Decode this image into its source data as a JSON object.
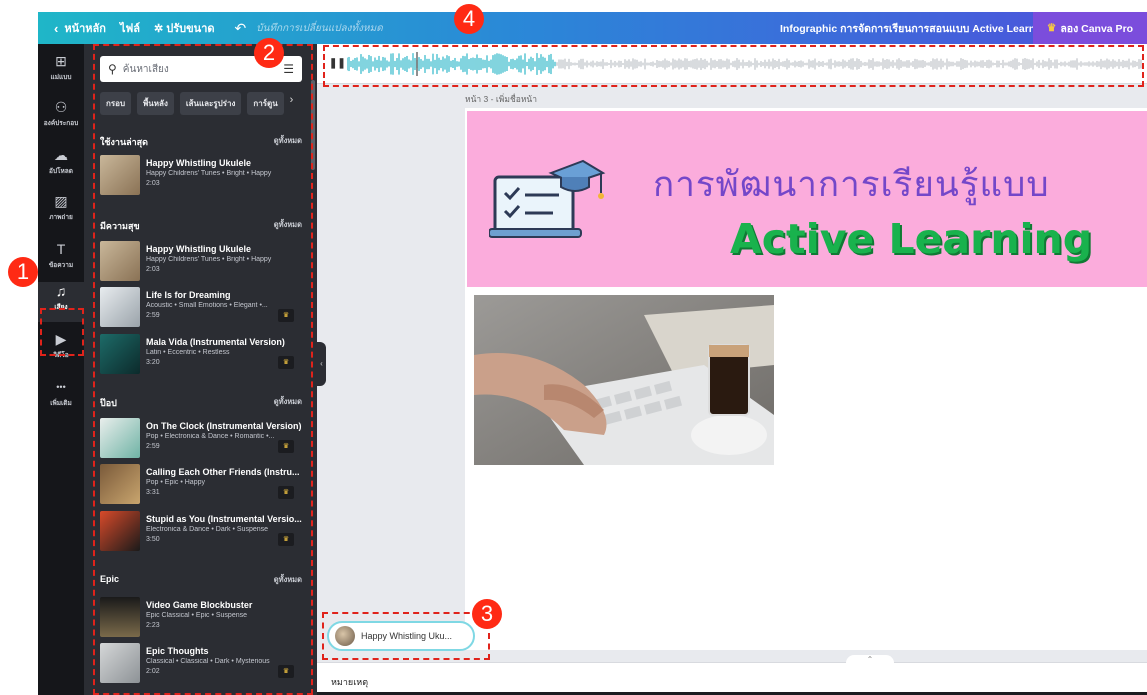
{
  "topbar": {
    "back_icon": "chevron-left-icon",
    "home_label": "หน้าหลัก",
    "file_label": "ไฟล์",
    "resize_label": "✲ ปรับขนาด",
    "undo_icon": "undo-icon",
    "autosave_text": "บันทึกการเปลี่ยนแปลงทั้งหมด",
    "doc_title": "Infographic การจัดการเรียนการสอนแบบ Active Learning",
    "pro_button": "ลอง Canva Pro"
  },
  "rail": {
    "items": [
      {
        "icon": "template-icon",
        "glyph": "⊞",
        "label": "แม่แบบ"
      },
      {
        "icon": "elements-icon",
        "glyph": "⚇",
        "label": "องค์ประกอบ"
      },
      {
        "icon": "upload-icon",
        "glyph": "☁",
        "label": "อัปโหลด"
      },
      {
        "icon": "photo-icon",
        "glyph": "▨",
        "label": "ภาพถ่าย"
      },
      {
        "icon": "text-icon",
        "glyph": "T",
        "label": "ข้อความ"
      },
      {
        "icon": "music-icon",
        "glyph": "♫",
        "label": "เสียง"
      },
      {
        "icon": "video-icon",
        "glyph": "▶",
        "label": "วิดีโอ"
      },
      {
        "icon": "more-icon",
        "glyph": "•••",
        "label": "เพิ่มเติม"
      }
    ]
  },
  "panel": {
    "search_placeholder": "ค้นหาเสียง",
    "chips": [
      "กรอบ",
      "พื้นหลัง",
      "เส้นและรูปร่าง",
      "การ์ตูน"
    ],
    "sections": [
      {
        "title": "ใช้งานล่าสุด",
        "see_all": "ดูทั้งหมด",
        "tracks": [
          {
            "title": "Happy Whistling Ukulele",
            "meta": "Happy Childrens' Tunes • Bright • Happy",
            "duration": "2:03",
            "pro": false,
            "thumb": "linear-gradient(135deg,#c9b79a,#8a7255)"
          }
        ]
      },
      {
        "title": "มีความสุข",
        "see_all": "ดูทั้งหมด",
        "tracks": [
          {
            "title": "Happy Whistling Ukulele",
            "meta": "Happy Childrens' Tunes • Bright • Happy",
            "duration": "2:03",
            "pro": false,
            "thumb": "linear-gradient(135deg,#c9b79a,#8a7255)"
          },
          {
            "title": "Life Is for Dreaming",
            "meta": "Acoustic • Small Emotions • Elegant •...",
            "duration": "2:59",
            "pro": true,
            "thumb": "linear-gradient(135deg,#e8ecef,#9aa3aa)"
          },
          {
            "title": "Mala Vida (Instrumental Version)",
            "meta": "Latin • Eccentric • Restless",
            "duration": "3:20",
            "pro": true,
            "thumb": "linear-gradient(135deg,#1d6b68,#0c2a2b)"
          }
        ]
      },
      {
        "title": "ป๊อป",
        "see_all": "ดูทั้งหมด",
        "tracks": [
          {
            "title": "On The Clock (Instrumental Version)",
            "meta": "Pop • Electronica & Dance • Romantic •...",
            "duration": "2:59",
            "pro": true,
            "thumb": "linear-gradient(135deg,#e9eeec,#6fb3a5)"
          },
          {
            "title": "Calling Each Other Friends (Instru...",
            "meta": "Pop • Epic • Happy",
            "duration": "3:31",
            "pro": true,
            "thumb": "linear-gradient(135deg,#7a5a3a,#c9a56e)"
          },
          {
            "title": "Stupid as You (Instrumental Versio...",
            "meta": "Electronica & Dance • Dark • Suspense",
            "duration": "3:50",
            "pro": true,
            "thumb": "linear-gradient(135deg,#d84a2a,#1a1a1a)"
          }
        ]
      },
      {
        "title": "Epic",
        "see_all": "ดูทั้งหมด",
        "tracks": [
          {
            "title": "Video Game Blockbuster",
            "meta": "Epic Classical • Epic • Suspense",
            "duration": "2:23",
            "pro": false,
            "thumb": "linear-gradient(180deg,#1a1a1a,#7a6a4a)"
          },
          {
            "title": "Epic Thoughts",
            "meta": "Classical • Classical • Dark • Mysterious",
            "duration": "2:02",
            "pro": true,
            "thumb": "linear-gradient(135deg,#d5d7d8,#8d9296)"
          }
        ]
      }
    ]
  },
  "canvas": {
    "page_label": "หน้า 3 - เพิ่มชื่อหน้า",
    "banner_thai": "การพัฒนาการเรียนรู้แบบ",
    "banner_english": "Active Learning",
    "notes_label": "หมายเหตุ",
    "audio_pill_label": "Happy Whistling Uku..."
  },
  "annotations": [
    "1",
    "2",
    "3",
    "4"
  ],
  "colors": {
    "accent_red": "#e0231b",
    "banner_pink": "#fbacdc",
    "title_purple": "#7447c9",
    "title_green": "#19b24d",
    "wave_teal": "#2fb8c9"
  }
}
